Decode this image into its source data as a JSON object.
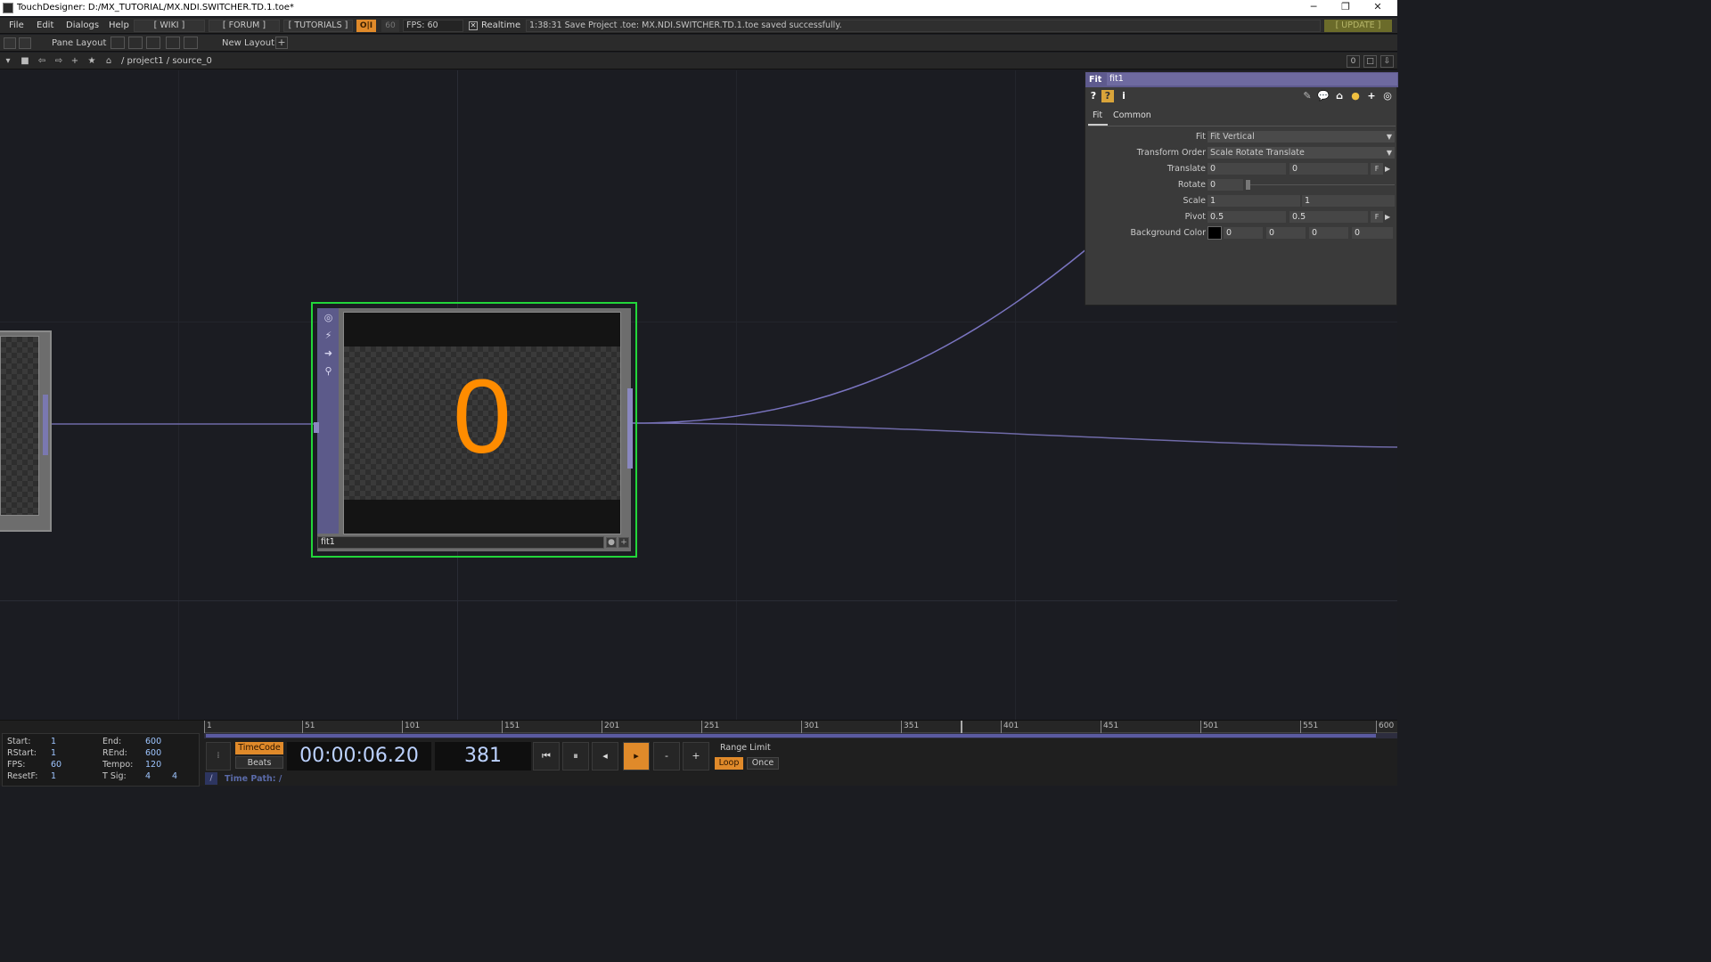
{
  "window": {
    "title": "TouchDesigner: D:/MX_TUTORIAL/MX.NDI.SWITCHER.TD.1.toe*",
    "minimize": "─",
    "restore": "❐",
    "close": "✕"
  },
  "menubar": {
    "items": [
      "File",
      "Edit",
      "Dialogs",
      "Help"
    ],
    "wiki": "[ WIKI ]",
    "forum": "[ FORUM ]",
    "tutorials": "[ TUTORIALS ]",
    "perf": "O|I",
    "fps_small": "60",
    "fps": "FPS:  60",
    "realtime_check": "✕",
    "realtime": "Realtime",
    "status": "1:38:31 Save Project .toe: MX.NDI.SWITCHER.TD.1.toe saved successfully.",
    "update": "[ UPDATE ]"
  },
  "toolbar": {
    "pane_layout": "Pane Layout",
    "new_layout": "New Layout",
    "plus": "+"
  },
  "pathbar": {
    "path": "/ project1 / source_0",
    "zero": "0"
  },
  "network": {
    "node": {
      "name": "fit1",
      "display_value": "0",
      "plus": "+"
    }
  },
  "params": {
    "op_type": "Fit",
    "op_name": "fit1",
    "tabs": [
      "Fit",
      "Common"
    ],
    "rows": {
      "fit": {
        "label": "Fit",
        "value": "Fit Vertical"
      },
      "transform_order": {
        "label": "Transform Order",
        "value": "Scale Rotate Translate"
      },
      "translate": {
        "label": "Translate",
        "x": "0",
        "y": "0"
      },
      "rotate": {
        "label": "Rotate",
        "value": "0"
      },
      "scale": {
        "label": "Scale",
        "x": "1",
        "y": "1"
      },
      "pivot": {
        "label": "Pivot",
        "x": "0.5",
        "y": "0.5"
      },
      "bgcolor": {
        "label": "Background Color",
        "r": "0",
        "g": "0",
        "b": "0",
        "a": "0",
        "swatch": "#000000"
      }
    },
    "f_button": "F"
  },
  "timeline": {
    "stats": {
      "start_label": "Start:",
      "start": "1",
      "end_label": "End:",
      "end": "600",
      "rstart_label": "RStart:",
      "rstart": "1",
      "rend_label": "REnd:",
      "rend": "600",
      "fps_label": "FPS:",
      "fps": "60",
      "tempo_label": "Tempo:",
      "tempo": "120",
      "resetf_label": "ResetF:",
      "resetf": "1",
      "tsig_label": "T Sig:",
      "tsig_a": "4",
      "tsig_b": "4"
    },
    "ruler_ticks": [
      "1",
      "51",
      "101",
      "151",
      "201",
      "251",
      "301",
      "351",
      "401",
      "451",
      "501",
      "551",
      "600"
    ],
    "timecode_btn": "TimeCode",
    "beats_btn": "Beats",
    "timecode": "00:00:06.20",
    "frame": "381",
    "range_limit": "Range Limit",
    "loop": "Loop",
    "once": "Once",
    "time_path": "Time Path: /",
    "minus": "-",
    "plus": "+"
  }
}
